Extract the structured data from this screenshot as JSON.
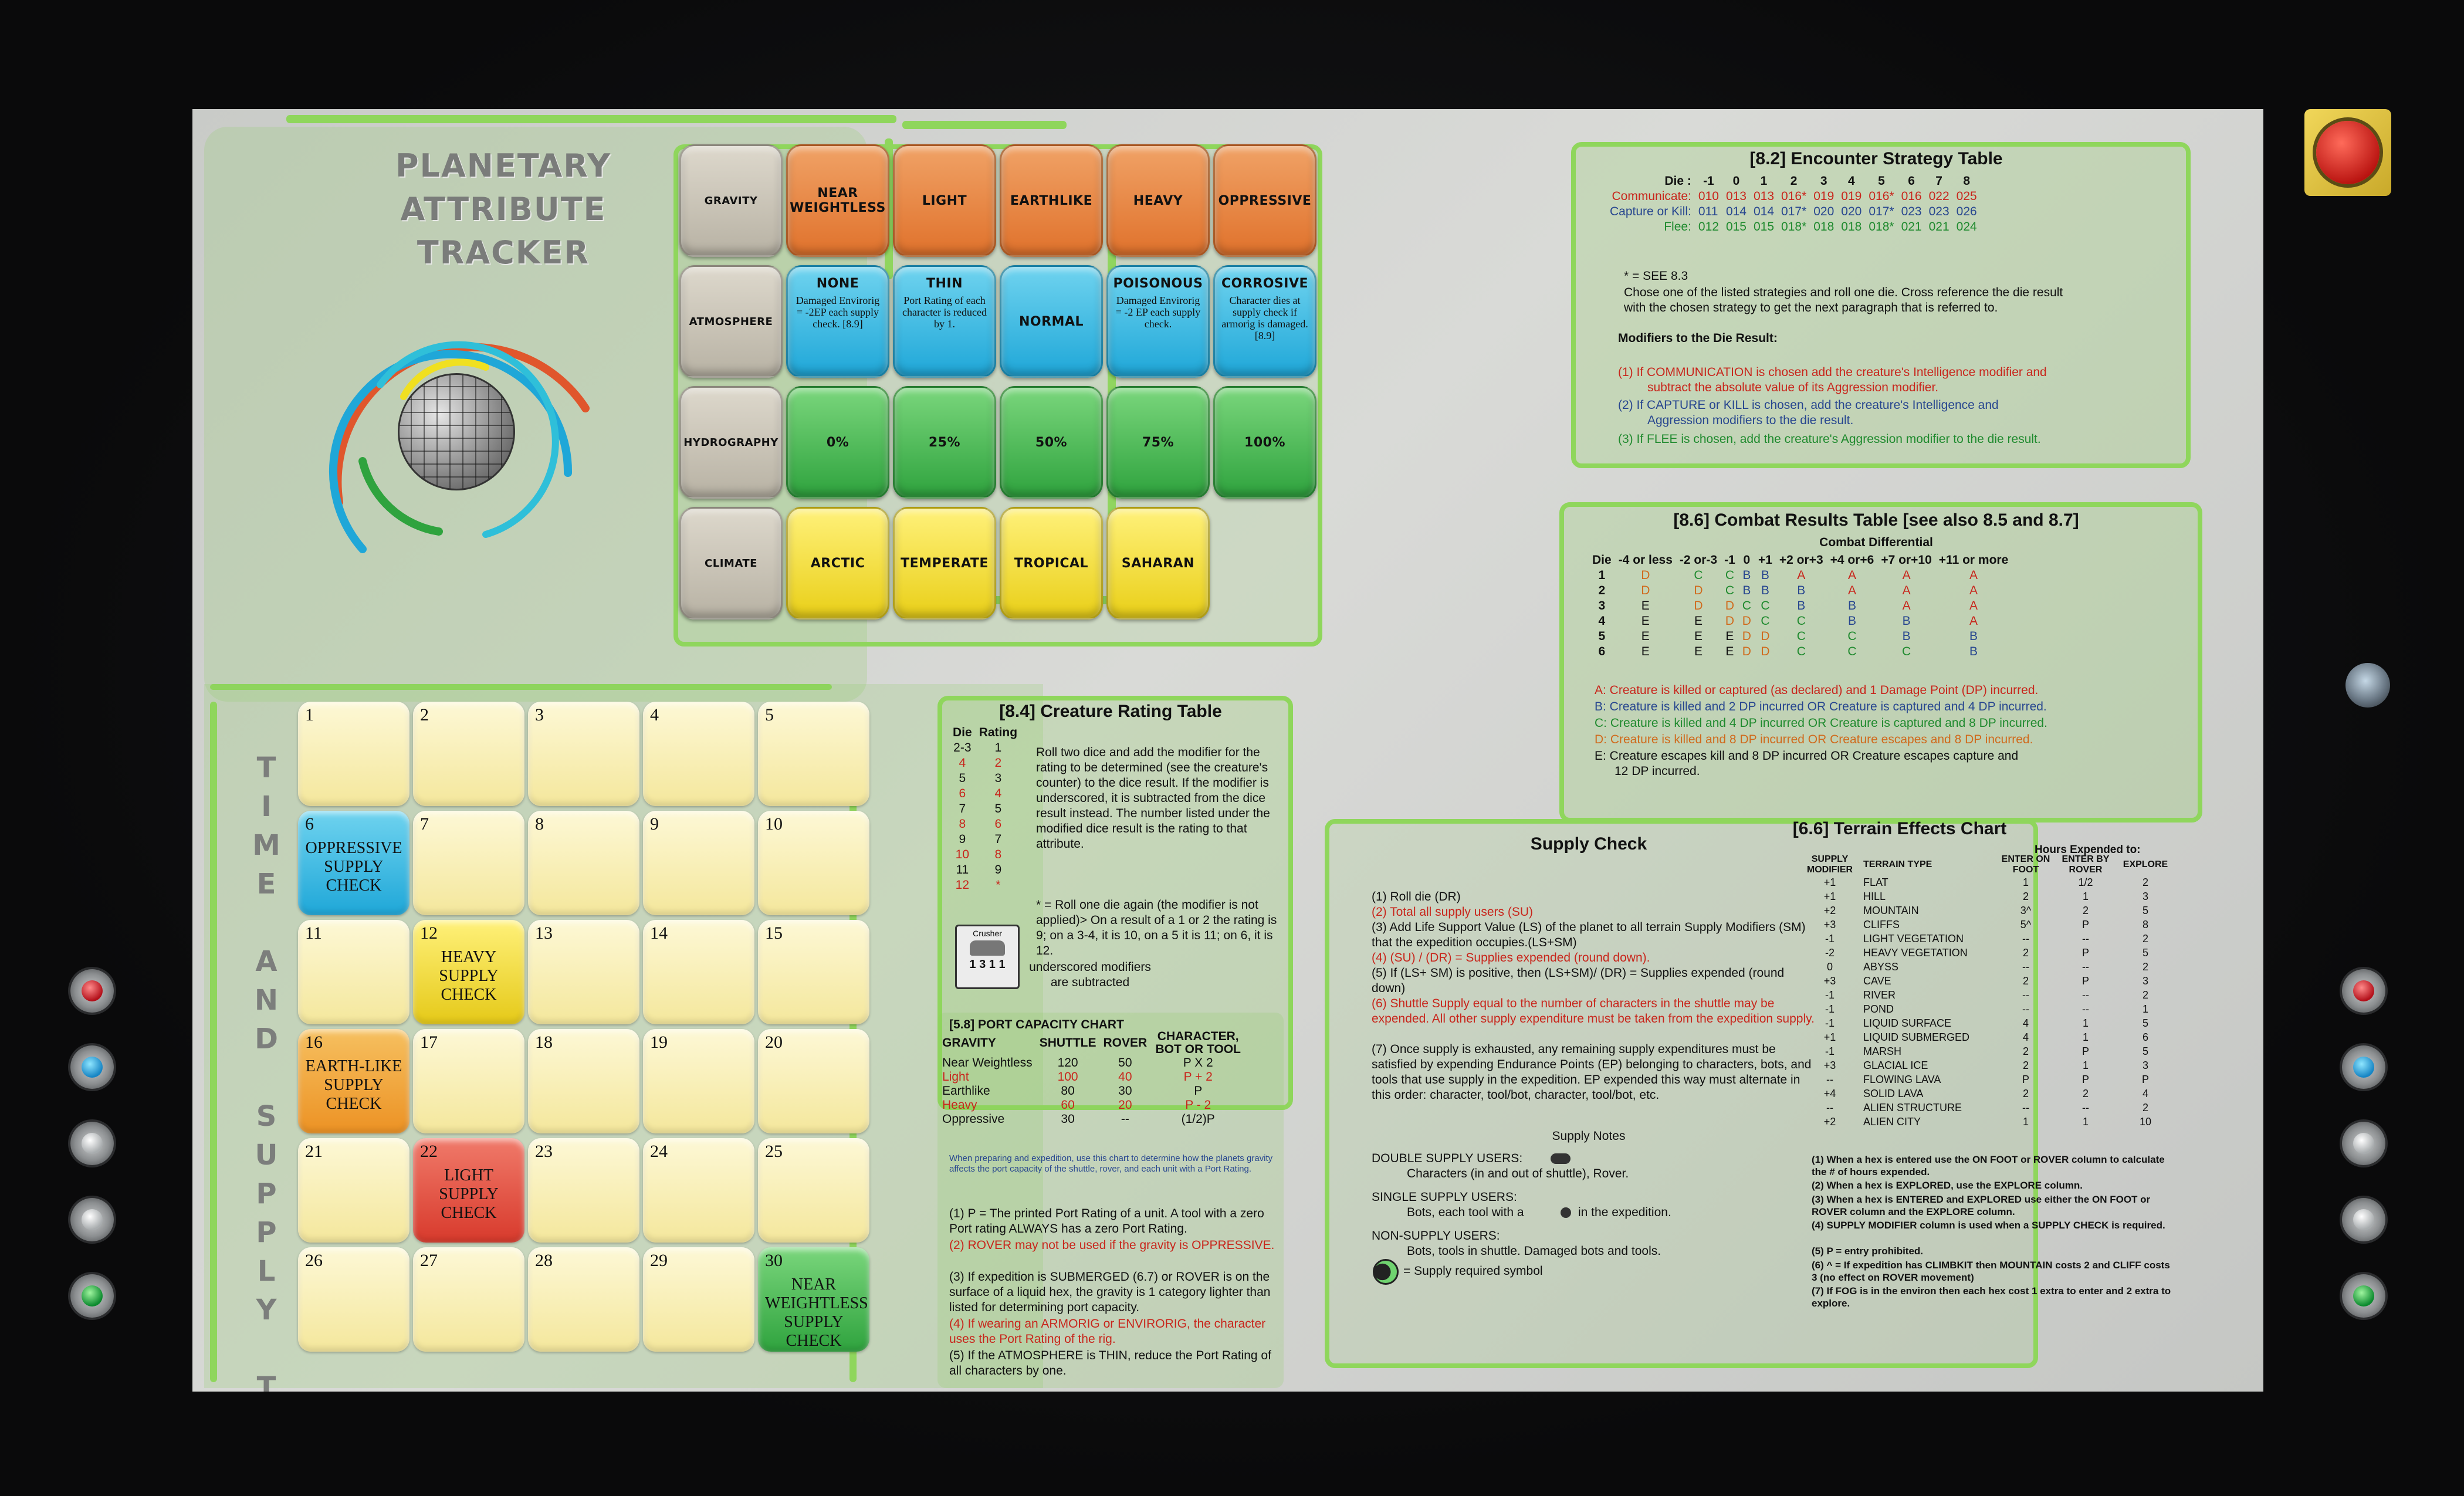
{
  "colors": {
    "board_bg": "#cfd0cd",
    "panel_green": "#8fd65c",
    "tile_orange": "#e0722c",
    "tile_cyan": "#1fa7d8",
    "tile_green": "#2fa33e",
    "tile_yellow": "#e9cf18",
    "text_red": "#c8261c",
    "text_blue": "#27468f",
    "text_green": "#1f8a2e"
  },
  "tracker": {
    "title_line1": "PLANETARY",
    "title_line2": "ATTRIBUTE",
    "title_line3": "TRACKER",
    "rows": [
      {
        "label": "GRAVITY",
        "values": [
          {
            "label": "NEAR WEIGHTLESS",
            "sub": ""
          },
          {
            "label": "LIGHT",
            "sub": ""
          },
          {
            "label": "EARTHLIKE",
            "sub": ""
          },
          {
            "label": "HEAVY",
            "sub": ""
          },
          {
            "label": "OPPRESSIVE",
            "sub": ""
          }
        ]
      },
      {
        "label": "ATMOSPHERE",
        "values": [
          {
            "label": "NONE",
            "sub": "Damaged Envirorig = -2EP each supply check. [8.9]"
          },
          {
            "label": "THIN",
            "sub": "Port Rating of each character is reduced by 1."
          },
          {
            "label": "NORMAL",
            "sub": ""
          },
          {
            "label": "POISONOUS",
            "sub": "Damaged Envirorig = -2 EP each supply check."
          },
          {
            "label": "CORROSIVE",
            "sub": "Character dies at supply check if armorig is damaged. [8.9]"
          }
        ]
      },
      {
        "label": "HYDROGRAPHY",
        "values": [
          {
            "label": "0%",
            "sub": ""
          },
          {
            "label": "25%",
            "sub": ""
          },
          {
            "label": "50%",
            "sub": ""
          },
          {
            "label": "75%",
            "sub": ""
          },
          {
            "label": "100%",
            "sub": ""
          }
        ]
      },
      {
        "label": "CLIMATE",
        "values": [
          {
            "label": "ARCTIC",
            "sub": ""
          },
          {
            "label": "TEMPERATE",
            "sub": ""
          },
          {
            "label": "TROPICAL",
            "sub": ""
          },
          {
            "label": "SAHARAN",
            "sub": ""
          }
        ]
      }
    ]
  },
  "track": {
    "title": "TIME AND SUPPLY TRACK",
    "days": [
      {
        "n": "1",
        "t": ""
      },
      {
        "n": "2",
        "t": ""
      },
      {
        "n": "3",
        "t": ""
      },
      {
        "n": "4",
        "t": ""
      },
      {
        "n": "5",
        "t": ""
      },
      {
        "n": "6",
        "t": "OPPRESSIVE SUPPLY CHECK"
      },
      {
        "n": "7",
        "t": ""
      },
      {
        "n": "8",
        "t": ""
      },
      {
        "n": "9",
        "t": ""
      },
      {
        "n": "10",
        "t": ""
      },
      {
        "n": "11",
        "t": ""
      },
      {
        "n": "12",
        "t": "HEAVY SUPPLY CHECK"
      },
      {
        "n": "13",
        "t": ""
      },
      {
        "n": "14",
        "t": ""
      },
      {
        "n": "15",
        "t": ""
      },
      {
        "n": "16",
        "t": "EARTH-LIKE SUPPLY CHECK"
      },
      {
        "n": "17",
        "t": ""
      },
      {
        "n": "18",
        "t": ""
      },
      {
        "n": "19",
        "t": ""
      },
      {
        "n": "20",
        "t": ""
      },
      {
        "n": "21",
        "t": ""
      },
      {
        "n": "22",
        "t": "LIGHT SUPPLY CHECK"
      },
      {
        "n": "23",
        "t": ""
      },
      {
        "n": "24",
        "t": ""
      },
      {
        "n": "25",
        "t": ""
      },
      {
        "n": "26",
        "t": ""
      },
      {
        "n": "27",
        "t": ""
      },
      {
        "n": "28",
        "t": ""
      },
      {
        "n": "29",
        "t": ""
      },
      {
        "n": "30",
        "t": "NEAR WEIGHTLESS SUPPLY CHECK"
      }
    ]
  },
  "encounter": {
    "title": "[8.2] Encounter Strategy Table",
    "die_label": "Die :",
    "dies": [
      "-1",
      "0",
      "1",
      "2",
      "3",
      "4",
      "5",
      "6",
      "7",
      "8"
    ],
    "rows": [
      {
        "name": "Communicate:",
        "vals": [
          "010",
          "013",
          "013",
          "016*",
          "019",
          "019",
          "016*",
          "016",
          "022",
          "025"
        ]
      },
      {
        "name": "Capture or Kill:",
        "vals": [
          "011",
          "014",
          "014",
          "017*",
          "020",
          "020",
          "017*",
          "023",
          "023",
          "026"
        ]
      },
      {
        "name": "Flee:",
        "vals": [
          "012",
          "015",
          "015",
          "018*",
          "018",
          "018",
          "018*",
          "021",
          "021",
          "024"
        ]
      }
    ],
    "see_note": "* = SEE 8.3",
    "desc1": "Chose one of the listed strategies and roll one die.  Cross reference the die result",
    "desc2": "with the chosen strategy to get the next paragraph that is referred to.",
    "mod_title": "Modifiers to the Die Result:",
    "mod1a": "(1) If COMMUNICATION is chosen add the creature's Intelligence modifier and",
    "mod1b": "subtract the absolute value of its Aggression modifier.",
    "mod2a": "(2) If CAPTURE or KILL is chosen, add the creature's Intelligence and",
    "mod2b": "Aggression modifiers to the die result.",
    "mod3": "(3)  If FLEE is chosen, add the creature's Aggression modifier to the die result."
  },
  "combat": {
    "title": "[8.6] Combat Results Table [see also 8.5 and 8.7]",
    "subtitle": "Combat Differential",
    "headers": [
      "Die",
      "-4 or less",
      "-2 or-3",
      "-1",
      "0",
      "+1",
      "+2 or+3",
      "+4 or+6",
      "+7 or+10",
      "+11 or more"
    ],
    "rows": [
      [
        "1",
        "D",
        "C",
        "C",
        "B",
        "B",
        "A",
        "A",
        "A",
        "A"
      ],
      [
        "2",
        "D",
        "D",
        "C",
        "B",
        "B",
        "B",
        "A",
        "A",
        "A"
      ],
      [
        "3",
        "E",
        "D",
        "D",
        "C",
        "C",
        "B",
        "B",
        "A",
        "A"
      ],
      [
        "4",
        "E",
        "E",
        "D",
        "D",
        "C",
        "C",
        "B",
        "B",
        "A"
      ],
      [
        "5",
        "E",
        "E",
        "E",
        "D",
        "D",
        "C",
        "C",
        "B",
        "B"
      ],
      [
        "6",
        "E",
        "E",
        "E",
        "D",
        "D",
        "C",
        "C",
        "C",
        "B"
      ]
    ],
    "legA": "A:  Creature is killed or captured (as declared) and 1 Damage Point (DP) incurred.",
    "legB": "B:  Creature is killed and 2 DP incurred  OR  Creature is captured and 4 DP incurred.",
    "legC": "C:  Creature is killed and 4 DP incurred OR Creature is captured and 8 DP incurred.",
    "legD": "D:  Creature is killed and 8 DP incurred  OR Creature escapes and 8 DP incurred.",
    "legE1": "E:  Creature escapes kill and 8 DP incurred OR Creature escapes capture and",
    "legE2": "12 DP incurred."
  },
  "creature": {
    "title": "[8.4] Creature Rating Table",
    "head_die": "Die",
    "head_rating": "Rating",
    "rows": [
      [
        "2-3",
        "1"
      ],
      [
        "4",
        "2"
      ],
      [
        "5",
        "3"
      ],
      [
        "6",
        "4"
      ],
      [
        "7",
        "5"
      ],
      [
        "8",
        "6"
      ],
      [
        "9",
        "7"
      ],
      [
        "10",
        "8"
      ],
      [
        "11",
        "9"
      ],
      [
        "12",
        "*"
      ]
    ],
    "desc": "Roll two dice and add the modifier for the rating to be determined (see the creature's counter) to the dice result. If the modifier is underscored, it is subtracted from the dice result instead.  The number listed under the modified dice result is the rating to that attribute.",
    "desc2": "* = Roll one die again (the modifier is not applied)>  On a result of a 1 or 2 the rating is 9; on a 3-4, it is 10, on a 5 it is 11; on 6, it is 12.",
    "counter_name": "Crusher",
    "counter_vals": "1 3 1 1",
    "under_note": "underscored modifiers are subtracted"
  },
  "port": {
    "title": "[5.8] PORT CAPACITY CHART",
    "headers": [
      "GRAVITY",
      "SHUTTLE",
      "ROVER",
      "CHARACTER, BOT OR TOOL"
    ],
    "rows": [
      [
        "Near Weightless",
        "120",
        "50",
        "P X 2"
      ],
      [
        "Light",
        "100",
        "40",
        "P + 2"
      ],
      [
        "Earthlike",
        "80",
        "30",
        "P"
      ],
      [
        "Heavy",
        "60",
        "20",
        "P - 2"
      ],
      [
        "Oppressive",
        "30",
        "--",
        "(1/2)P"
      ]
    ],
    "blue_note": "When preparing and expedition, use this chart to determine how the planets gravity affects the port capacity of the shuttle, rover, and each unit with a Port Rating.",
    "n1": "(1) P = The printed Port Rating of a unit.  A tool with a zero Port rating ALWAYS has a zero Port Rating.",
    "n2": "(2) ROVER may not be used if the gravity is OPPRESSIVE.",
    "n3": "(3)  If expedition is SUBMERGED (6.7) or ROVER is on the surface of a liquid hex, the gravity is 1 category lighter than listed for determining port capacity.",
    "n4": "(4)  If wearing an ARMORIG or ENVIRORIG, the character uses the Port Rating of the rig.",
    "n5": "(5)  If the ATMOSPHERE is THIN, reduce the Port Rating of all characters by one."
  },
  "supply": {
    "title": "Supply Check",
    "s1": "(1) Roll die (DR)",
    "s2": "(2) Total all supply users (SU)",
    "s3": "(3) Add Life Support Value (LS) of the planet to all terrain Supply Modifiers (SM) that the expedition occupies.(LS+SM)",
    "s4": "(4)  (SU) / (DR) = Supplies expended (round down).",
    "s5": "(5)  If (LS+ SM) is positive, then (LS+SM)/ (DR) = Supplies expended (round down)",
    "s6": "(6)  Shuttle Supply equal to the number of characters in the shuttle may be expended.  All other supply expenditure must be taken from the expedition supply.",
    "s7": "(7)  Once supply is exhausted, any remaining supply expenditures must be satisfied by expending Endurance Points (EP) belonging to characters, bots, and tools that use supply in the expedition.  EP expended this way must alternate in this order: character, tool/bot, character, tool/bot, etc.",
    "notes_title": "Supply Notes",
    "double_title": "DOUBLE SUPPLY USERS:",
    "double_text": "Characters (in and out of shuttle), Rover.",
    "single_title": "SINGLE SUPPLY USERS:",
    "single_text": "Bots, each tool with a",
    "single_text2": "in the expedition.",
    "non_title": "NON-SUPPLY USERS:",
    "non_text": "Bots, tools in shuttle.  Damaged bots and tools.",
    "symbol_text": "= Supply required symbol"
  },
  "terrain": {
    "title": "[6.6] Terrain Effects Chart",
    "hours_title": "Hours Expended to:",
    "headers": [
      "SUPPLY MODIFIER",
      "TERRAIN TYPE",
      "ENTER ON FOOT",
      "ENTER BY ROVER",
      "EXPLORE"
    ],
    "rows": [
      [
        "+1",
        "FLAT",
        "1",
        "1/2",
        "2"
      ],
      [
        "+1",
        "HILL",
        "2",
        "1",
        "3"
      ],
      [
        "+2",
        "MOUNTAIN",
        "3^",
        "2",
        "5"
      ],
      [
        "+3",
        "CLIFFS",
        "5^",
        "P",
        "8"
      ],
      [
        "-1",
        "LIGHT VEGETATION",
        "--",
        "--",
        "2"
      ],
      [
        "-2",
        "HEAVY VEGETATION",
        "2",
        "P",
        "5"
      ],
      [
        "0",
        "ABYSS",
        "--",
        "--",
        "2"
      ],
      [
        "+3",
        "CAVE",
        "2",
        "P",
        "3"
      ],
      [
        "-1",
        "RIVER",
        "--",
        "--",
        "2"
      ],
      [
        "-1",
        "POND",
        "--",
        "--",
        "1"
      ],
      [
        "-1",
        "LIQUID SURFACE",
        "4",
        "1",
        "5"
      ],
      [
        "+1",
        "LIQUID SUBMERGED",
        "4",
        "1",
        "6"
      ],
      [
        "-1",
        "MARSH",
        "2",
        "P",
        "5"
      ],
      [
        "+3",
        "GLACIAL ICE",
        "2",
        "1",
        "3"
      ],
      [
        "--",
        "FLOWING LAVA",
        "P",
        "P",
        "P"
      ],
      [
        "+4",
        "SOLID LAVA",
        "2",
        "2",
        "4"
      ],
      [
        "--",
        "ALIEN STRUCTURE",
        "--",
        "--",
        "2"
      ],
      [
        "+2",
        "ALIEN CITY",
        "1",
        "1",
        "10"
      ]
    ],
    "n1": "(1) When a hex is entered use the ON FOOT or ROVER column to calculate the # of hours expended.",
    "n2": "(2) When a hex is EXPLORED, use the EXPLORE column.",
    "n3": "(3) When a hex is ENTERED and EXPLORED use either the ON FOOT or ROVER column and the EXPLORE column.",
    "n4": "(4) SUPPLY MODIFIER column is used when a SUPPLY CHECK is required.",
    "n5": "(5) P = entry prohibited.",
    "n6": "(6)  ^ =  If expedition has CLIMBKIT then MOUNTAIN costs 2 and CLIFF costs 3 (no effect on ROVER movement)",
    "n7": "(7) If FOG is in the environ then each hex cost 1 extra to enter and 2 extra to explore."
  },
  "icons": {
    "globe": "wireframe-globe-icon",
    "supply_symbol": "supply-required-icon",
    "alarm_button": "red-alarm-button",
    "side_buttons": [
      "red-led-button",
      "blue-led-button",
      "white-led-button",
      "white-led-button",
      "green-led-button"
    ]
  }
}
